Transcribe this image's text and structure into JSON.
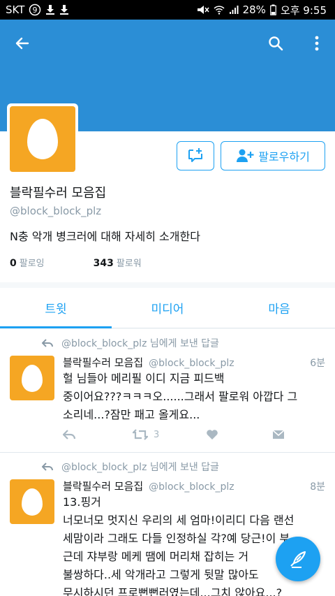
{
  "status_bar": {
    "carrier": "SKT",
    "battery": "28%",
    "time": "오후 9:55"
  },
  "colors": {
    "header_bg": "#2b8ed6",
    "accent": "#1da1f2",
    "avatar_bg": "#f5a623",
    "muted_text": "#8899a6"
  },
  "header": {
    "back_icon": "arrow-left-icon",
    "search_icon": "search-icon",
    "more_icon": "more-vert-icon"
  },
  "profile": {
    "name": "블락필수러 모음집",
    "handle": "@block_block_plz",
    "bio": "N충 악개 병크러에 대해 자세히 소개한다",
    "following_count": "0",
    "following_label": "팔로잉",
    "followers_count": "343",
    "followers_label": "팔로워",
    "follow_label": "팔로우하기"
  },
  "tabs": [
    {
      "label": "트윗",
      "active": true
    },
    {
      "label": "미디어",
      "active": false
    },
    {
      "label": "마음",
      "active": false
    }
  ],
  "tweets": [
    {
      "reply_to": "@block_block_plz 님에게 보낸 답글",
      "name": "블락필수러 모음집",
      "handle": "@block_block_plz",
      "time": "6분",
      "text": "헐 님들아 메리필 이디 지금 피드백\n중이어요???ㅋㅋㅋ오......그래서 팔로워 아깝다 그\n소리네...?잠만 패고 올게요...",
      "retweets": "3"
    },
    {
      "reply_to": "@block_block_plz 님에게 보낸 답글",
      "name": "블락필수러 모음집",
      "handle": "@block_block_plz",
      "time": "8분",
      "text": "13.핑거\n너모너모 멋지신 우리의 세 엄마!이리디 다음 랜선\n세맘이라 그래도 다들 인정하실 각?예 당근!이 부\n근데 쟈부랑 메케 땜에 머리채 잡히는 거\n불쌍하다..세 악개라고 그렇게 뒷말 많아도\n무시하시던 프로뻔뻔러였는데...그치 않아요...?",
      "retweets": ""
    }
  ],
  "compose": {
    "icon": "compose-feather-icon"
  }
}
